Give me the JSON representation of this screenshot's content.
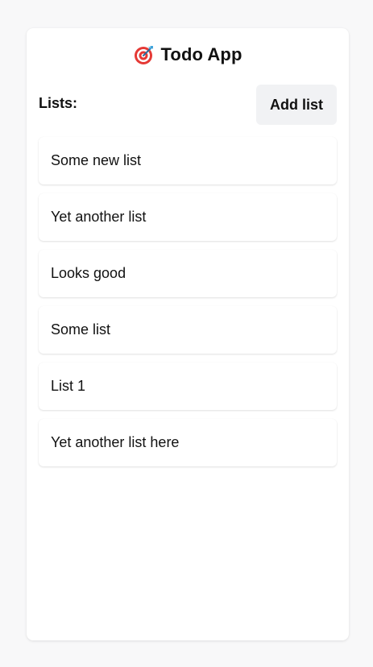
{
  "app": {
    "title": "Todo App",
    "icon": "target-bullseye-icon"
  },
  "header": {
    "lists_label": "Lists:",
    "add_list_label": "Add list"
  },
  "lists": [
    {
      "label": "Some new list"
    },
    {
      "label": "Yet another list"
    },
    {
      "label": "Looks good"
    },
    {
      "label": "Some list"
    },
    {
      "label": "List 1"
    },
    {
      "label": "Yet another list here"
    }
  ],
  "colors": {
    "card_background": "#ffffff",
    "page_background": "#f8f8f9",
    "button_background": "#f1f2f4",
    "text": "#111111",
    "target_red": "#e53935",
    "target_white": "#ffffff",
    "dart_blue": "#3fa7e0"
  }
}
